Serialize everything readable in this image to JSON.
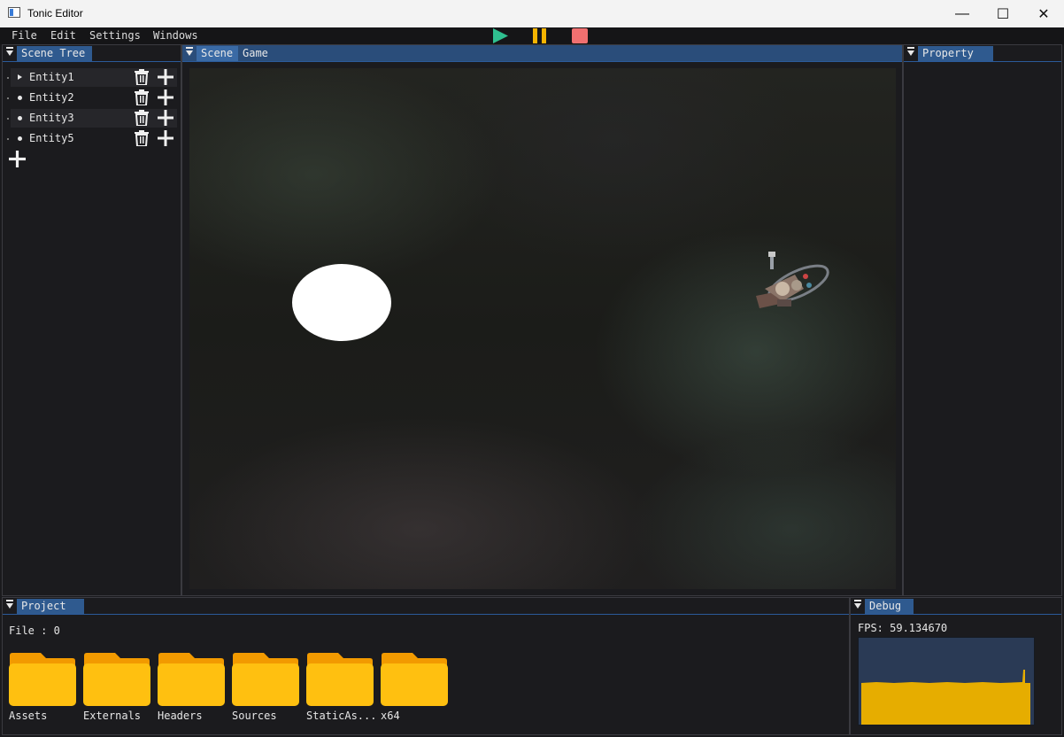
{
  "window": {
    "title": "Tonic Editor",
    "minimize": "—",
    "maximize": "☐",
    "close": "✕"
  },
  "menu": [
    "File",
    "Edit",
    "Settings",
    "Windows"
  ],
  "toolbar": {
    "play": "play-icon",
    "pause": "pause-icon",
    "stop": "stop-icon"
  },
  "colors": {
    "accent": "#2f5a8f",
    "play": "#2fbf8f",
    "pause": "#f5b400",
    "stop": "#f07070",
    "folder": "#ffc010",
    "graph_fill": "#e6ad00"
  },
  "scene_tree": {
    "tab": "Scene Tree",
    "entities": [
      "Entity1",
      "Entity2",
      "Entity3",
      "Entity5"
    ]
  },
  "viewport": {
    "tabs": [
      "Scene",
      "Game"
    ]
  },
  "property": {
    "tab": "Property"
  },
  "project": {
    "tab": "Project",
    "file_count": "File : 0",
    "folders": [
      "Assets",
      "Externals",
      "Headers",
      "Sources",
      "StaticAs...",
      "x64"
    ]
  },
  "debug": {
    "tab": "Debug",
    "fps": "FPS: 59.134670"
  }
}
